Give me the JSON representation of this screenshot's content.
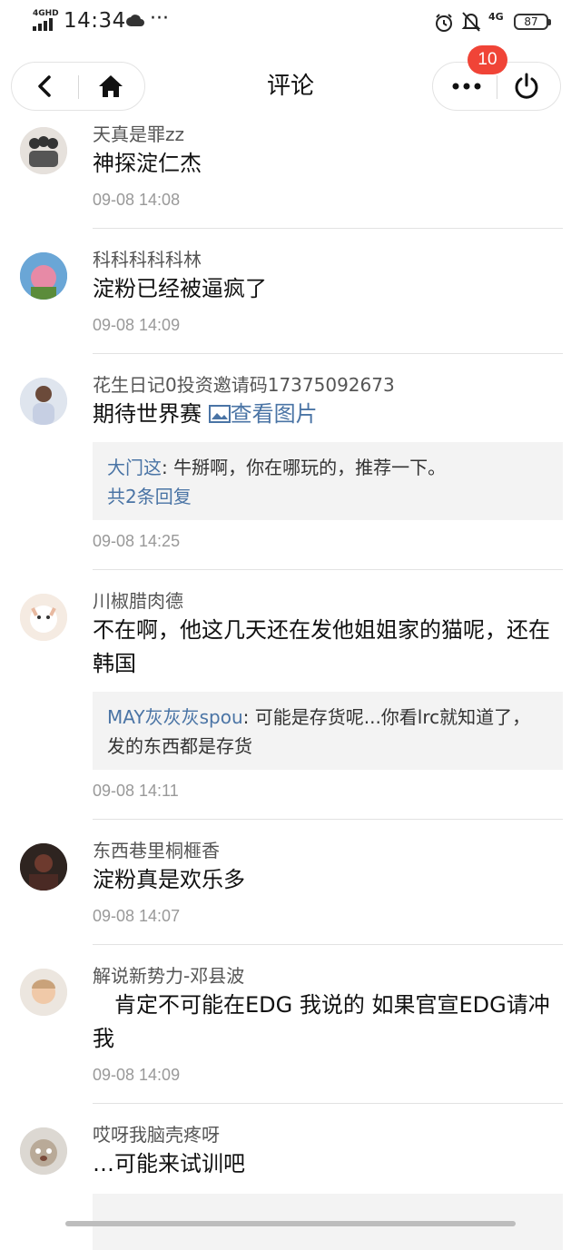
{
  "status_bar": {
    "network": "4GHD",
    "time": "14:34",
    "signal_right": "4G",
    "battery": "87"
  },
  "nav": {
    "title": "评论",
    "badge": "10"
  },
  "comments": [
    {
      "user": "天真是罪zz",
      "text": "神探淀仁杰",
      "time": "09-08 14:08"
    },
    {
      "user": "科科科科科林",
      "text": "淀粉已经被逼疯了",
      "time": "09-08 14:09"
    },
    {
      "user": "花生日记0投资邀请码17375092673",
      "text": "期待世界赛",
      "pic_label": "查看图片",
      "reply": {
        "user": "大门这",
        "text": ": 牛掰啊，你在哪玩的，推荐一下。",
        "more": "共2条回复"
      },
      "time": "09-08 14:25"
    },
    {
      "user": "川椒腊肉德",
      "text": "不在啊，他这几天还在发他姐姐家的猫呢，还在韩国",
      "reply": {
        "user": "MAY灰灰灰spou",
        "text": ": 可能是存货呢...你看lrc就知道了，发的东西都是存货"
      },
      "time": "09-08 14:11"
    },
    {
      "user": "东西巷里桐榧香",
      "text": "淀粉真是欢乐多",
      "time": "09-08 14:07"
    },
    {
      "user": "解说新势力-邓县波",
      "text": "　肯定不可能在EDG 我说的 如果官宣EDG请冲我",
      "time": "09-08 14:09"
    },
    {
      "user": "哎呀我脑壳疼呀",
      "text": "…可能来试训吧"
    }
  ]
}
